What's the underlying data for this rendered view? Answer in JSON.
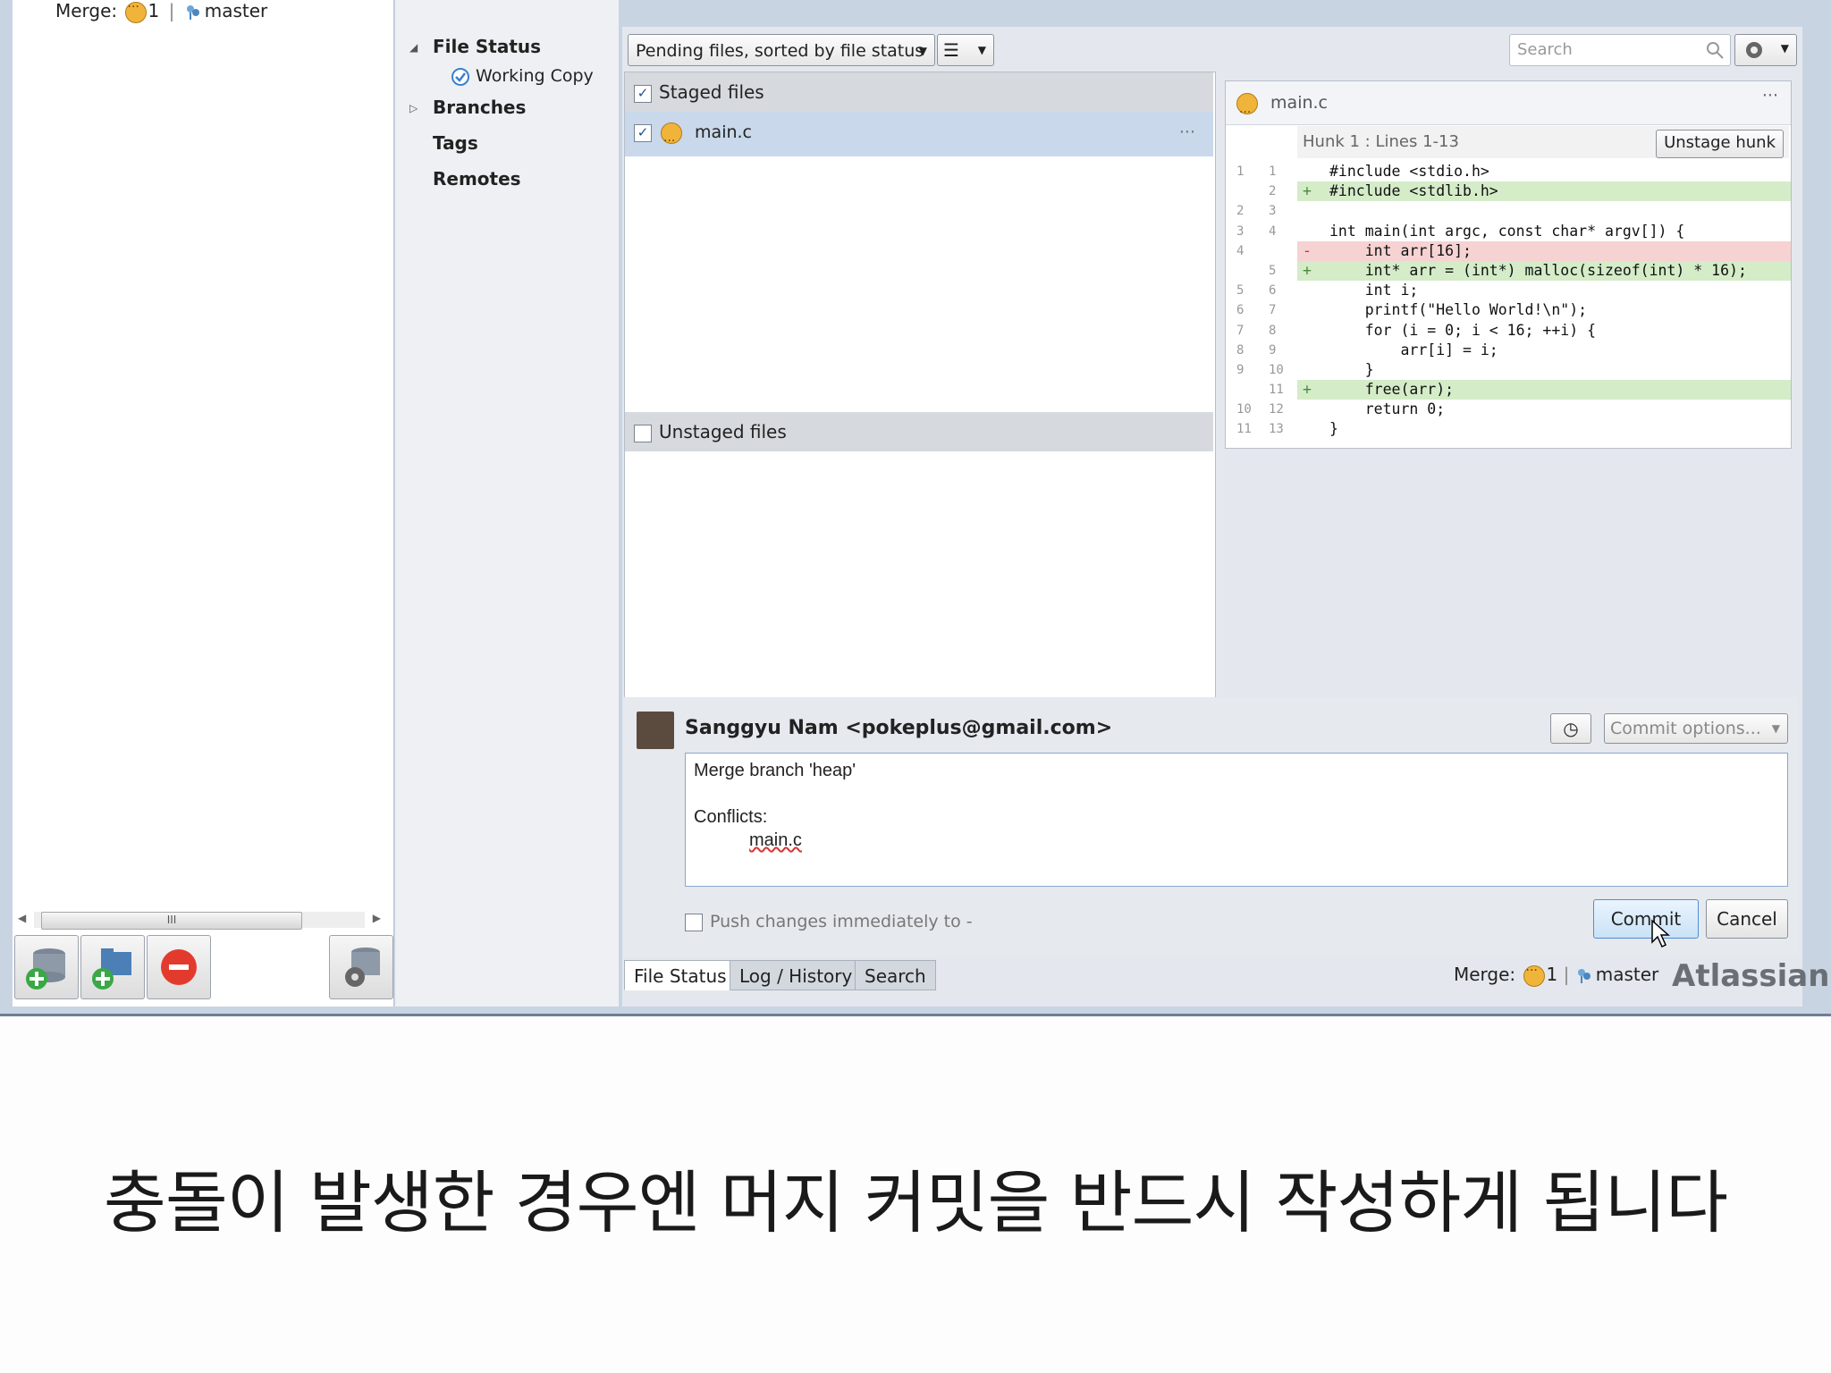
{
  "repo_header": {
    "merge_label": "Merge:",
    "conflict_count": "1",
    "branch": "master"
  },
  "nav": {
    "file_status": "File Status",
    "working_copy": "Working Copy",
    "branches": "Branches",
    "tags": "Tags",
    "remotes": "Remotes"
  },
  "toolbar": {
    "filter_select": "Pending files, sorted by file status",
    "search_placeholder": "Search"
  },
  "staged": {
    "header": "Staged files",
    "files": [
      {
        "name": "main.c"
      }
    ]
  },
  "unstaged": {
    "header": "Unstaged files"
  },
  "diff": {
    "file": "main.c",
    "hunk_title": "Hunk 1 : Lines 1-13",
    "unstage_label": "Unstage hunk",
    "lines": [
      {
        "o": "1",
        "n": "1",
        "m": "",
        "t": "#include <stdio.h>",
        "k": ""
      },
      {
        "o": "",
        "n": "2",
        "m": "+",
        "t": "#include <stdlib.h>",
        "k": "add"
      },
      {
        "o": "2",
        "n": "3",
        "m": "",
        "t": "",
        "k": ""
      },
      {
        "o": "3",
        "n": "4",
        "m": "",
        "t": "int main(int argc, const char* argv[]) {",
        "k": ""
      },
      {
        "o": "4",
        "n": "",
        "m": "-",
        "t": "    int arr[16];",
        "k": "del"
      },
      {
        "o": "",
        "n": "5",
        "m": "+",
        "t": "    int* arr = (int*) malloc(sizeof(int) * 16);",
        "k": "add"
      },
      {
        "o": "5",
        "n": "6",
        "m": "",
        "t": "    int i;",
        "k": ""
      },
      {
        "o": "6",
        "n": "7",
        "m": "",
        "t": "    printf(\"Hello World!\\n\");",
        "k": ""
      },
      {
        "o": "7",
        "n": "8",
        "m": "",
        "t": "    for (i = 0; i < 16; ++i) {",
        "k": ""
      },
      {
        "o": "8",
        "n": "9",
        "m": "",
        "t": "        arr[i] = i;",
        "k": ""
      },
      {
        "o": "9",
        "n": "10",
        "m": "",
        "t": "    }",
        "k": ""
      },
      {
        "o": "",
        "n": "11",
        "m": "+",
        "t": "    free(arr);",
        "k": "add"
      },
      {
        "o": "10",
        "n": "12",
        "m": "",
        "t": "    return 0;",
        "k": ""
      },
      {
        "o": "11",
        "n": "13",
        "m": "",
        "t": "}",
        "k": ""
      }
    ]
  },
  "commit": {
    "author": "Sanggyu Nam <pokeplus@gmail.com>",
    "message_line1": "Merge branch 'heap'",
    "message_line2": "Conflicts:",
    "message_line3": "main.c",
    "options_label": "Commit options...",
    "push_label": "Push changes immediately to -",
    "commit_label": "Commit",
    "cancel_label": "Cancel"
  },
  "bottom_tabs": {
    "file_status": "File Status",
    "log": "Log / History",
    "search": "Search"
  },
  "status_bar": {
    "merge_label": "Merge:",
    "conflict_count": "1",
    "branch": "master",
    "brand": "Atlassian"
  },
  "caption": "충돌이 발생한 경우엔 머지 커밋을 반드시 작성하게 됩니다"
}
